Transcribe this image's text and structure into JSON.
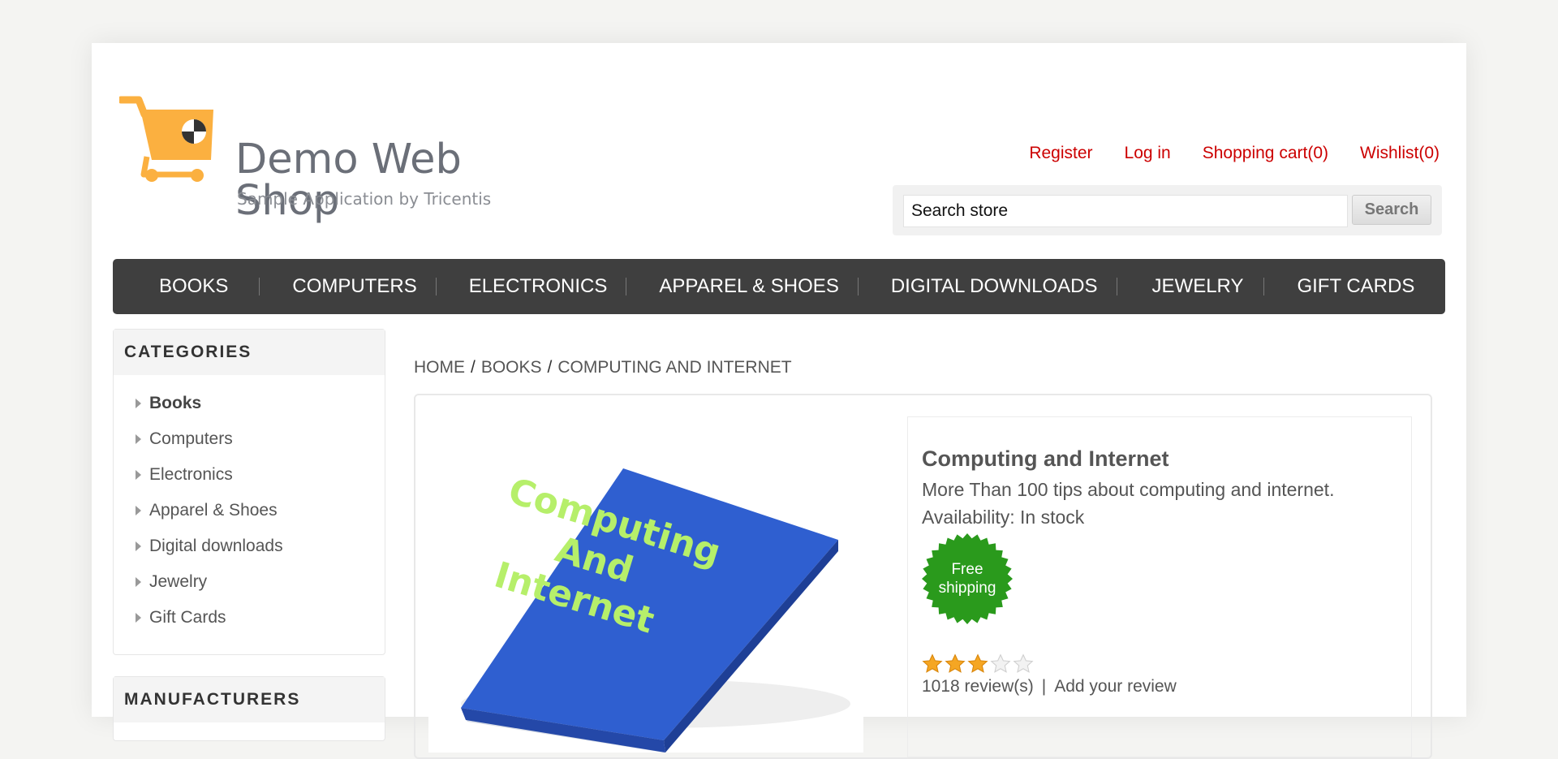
{
  "logo": {
    "title": "Demo Web Shop",
    "subtitle": "Sample Application by Tricentis",
    "icon": "shopping-cart-logo-icon",
    "color": "#fbb040"
  },
  "header_links": {
    "register": "Register",
    "login": "Log in",
    "cart": "Shopping cart(0)",
    "wishlist": "Wishlist(0)"
  },
  "search": {
    "value": "Search store",
    "button": "Search"
  },
  "top_menu": [
    "BOOKS",
    "COMPUTERS",
    "ELECTRONICS",
    "APPAREL & SHOES",
    "DIGITAL DOWNLOADS",
    "JEWELRY",
    "GIFT CARDS"
  ],
  "categories": {
    "title": "CATEGORIES",
    "items": [
      "Books",
      "Computers",
      "Electronics",
      "Apparel & Shoes",
      "Digital downloads",
      "Jewelry",
      "Gift Cards"
    ],
    "active": "Books"
  },
  "manufacturers": {
    "title": "MANUFACTURERS"
  },
  "breadcrumb": {
    "home": "HOME",
    "category": "BOOKS",
    "current": "COMPUTING AND INTERNET"
  },
  "product": {
    "name": "Computing and Internet",
    "short_description": "More Than 100 tips about computing and internet.",
    "availability": "Availability: In stock",
    "badge": {
      "line1": "Free",
      "line2": "shipping",
      "color": "#2a9a1c"
    },
    "image": {
      "text_line1": "Computing",
      "text_line2": "And",
      "text_line3": "Internet",
      "book_color": "#2f5fd0",
      "text_color": "#b6ef6a"
    },
    "rating": 3,
    "rating_max": 5,
    "reviews": "1018 review(s)",
    "separator": "|",
    "add_review": "Add your review"
  },
  "colors": {
    "link": "#cc0000",
    "menu_bg": "#3f3f3f",
    "star": "#f5a623"
  }
}
